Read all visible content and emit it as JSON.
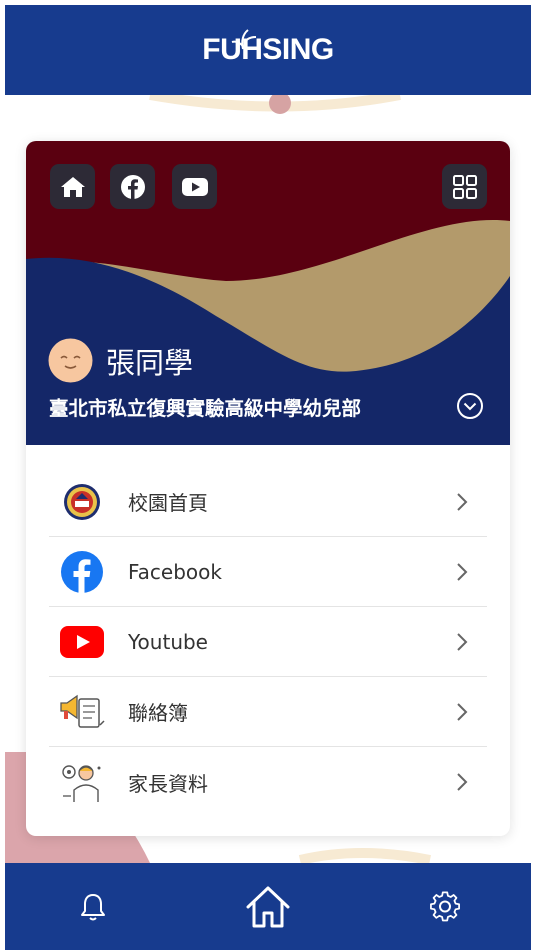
{
  "header": {
    "logo_text": "FUHSING",
    "logo_icon": "leaf-icon"
  },
  "colors": {
    "brand_blue": "#173b8e",
    "hero_maroon": "#5a0010",
    "hero_gold": "#b39a6b",
    "hero_navy": "#142768",
    "icon_button_bg": "#2d2a36"
  },
  "hero": {
    "quick_links": [
      {
        "name": "home",
        "icon": "home-icon"
      },
      {
        "name": "facebook",
        "icon": "facebook-icon"
      },
      {
        "name": "youtube",
        "icon": "youtube-icon"
      }
    ],
    "apps_icon": "grid-icon",
    "avatar_icon": "smiley-avatar-icon",
    "student_name": "張同學",
    "school_name": "臺北市私立復興實驗高級中學幼兒部",
    "expand_icon": "chevron-down-circle-icon"
  },
  "menu": {
    "items": [
      {
        "label": "校園首頁",
        "icon": "school-emblem-icon"
      },
      {
        "label": "Facebook",
        "icon": "facebook-icon"
      },
      {
        "label": "Youtube",
        "icon": "youtube-icon"
      },
      {
        "label": "聯絡簿",
        "icon": "megaphone-notebook-icon"
      },
      {
        "label": "家長資料",
        "icon": "parent-profile-icon"
      }
    ]
  },
  "bottom_nav": [
    {
      "name": "notifications",
      "icon": "bell-icon"
    },
    {
      "name": "home",
      "icon": "home-outline-icon"
    },
    {
      "name": "settings",
      "icon": "gear-icon"
    }
  ]
}
